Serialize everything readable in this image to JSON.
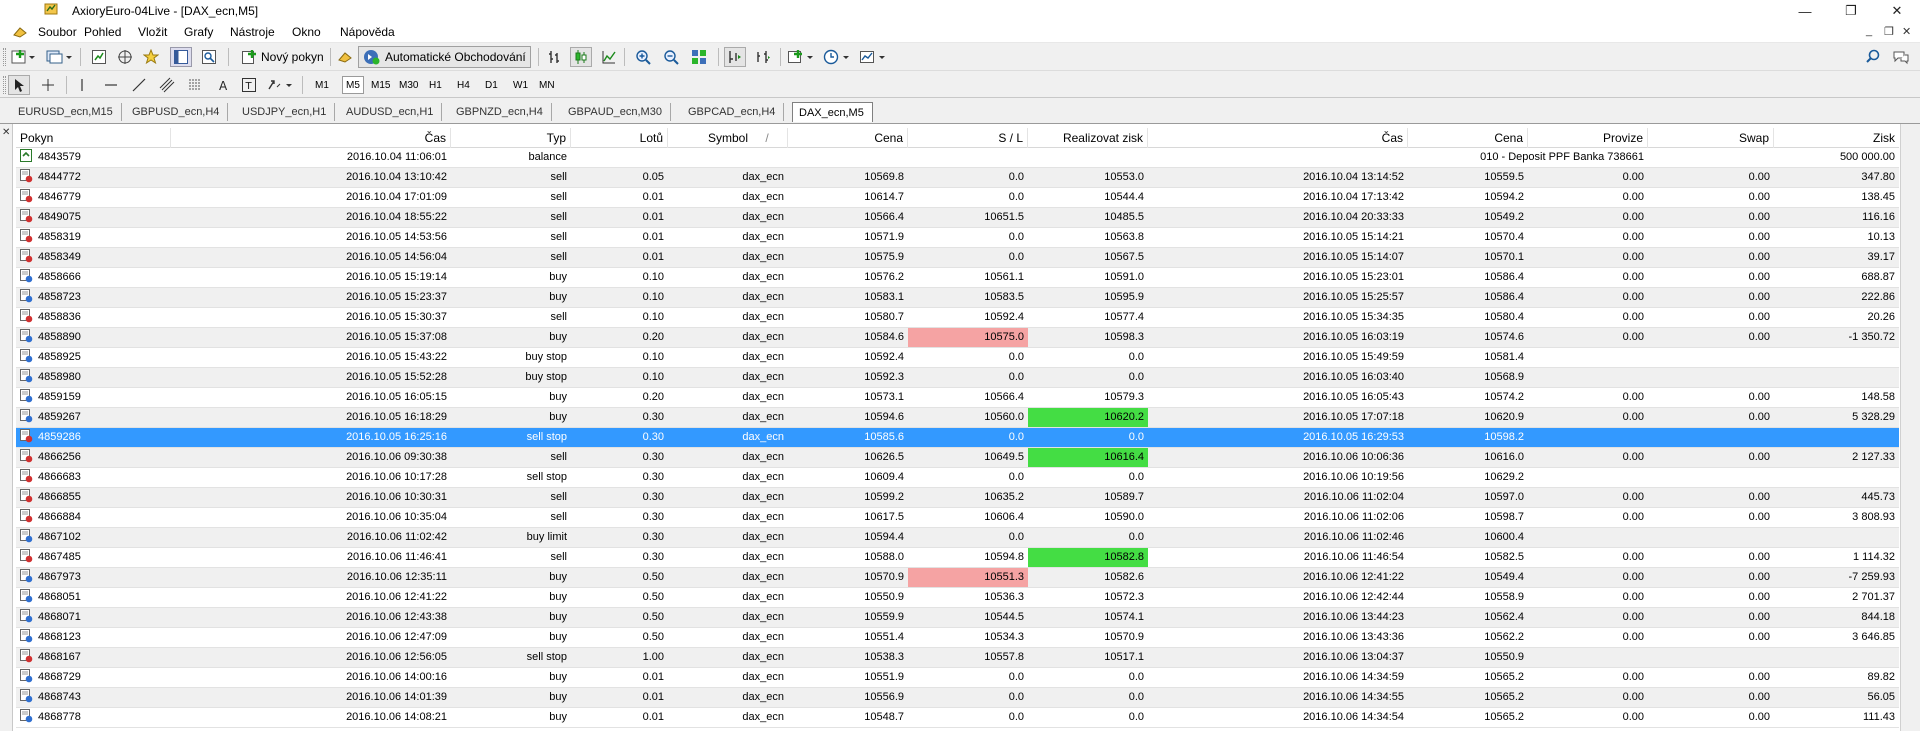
{
  "window": {
    "title": "AxioryEuro-04Live - [DAX_ecn,M5]",
    "minimize": "—",
    "maximize": "❐",
    "close": "✕"
  },
  "menu": {
    "items": [
      "Soubor",
      "Pohled",
      "Vložit",
      "Grafy",
      "Nástroje",
      "Okno",
      "Nápověda"
    ],
    "mdi": [
      "_",
      "❐",
      "✕"
    ]
  },
  "toolbar": {
    "new_order": "Nový pokyn",
    "autotrading": "Automatické Obchodování",
    "timeframes": [
      "M1",
      "M5",
      "M15",
      "M30",
      "H1",
      "H4",
      "D1",
      "W1",
      "MN"
    ],
    "active_timeframe": "M5"
  },
  "tabs": [
    "EURUSD_ecn,M15",
    "GBPUSD_ecn,H4",
    "USDJPY_ecn,H1",
    "AUDUSD_ecn,H1",
    "GBPNZD_ecn,H4",
    "GBPAUD_ecn,M30",
    "GBPCAD_ecn,H4",
    "DAX_ecn,M5"
  ],
  "active_tab": "DAX_ecn,M5",
  "columns": [
    "Pokyn",
    "Čas",
    "Typ",
    "Lotů",
    "Symbol",
    "Cena",
    "S / L",
    "Realizovat zisk",
    "Čas",
    "Cena",
    "Provize",
    "Swap",
    "Zisk"
  ],
  "sort_indicator": "/",
  "colors": {
    "selected": "#3399ff",
    "sl_hit": "#f5a3a3",
    "tp_hit": "#44dd44"
  },
  "rows": [
    {
      "id": "4843579",
      "time": "2016.10.04 11:06:01",
      "type": "balance",
      "lots": "",
      "symbol": "",
      "price": "",
      "sl": "",
      "tp": "",
      "ctime": "",
      "cprice": "",
      "commission": "010 - Deposit PPF Banka  738661",
      "swap": "",
      "profit": "500 000.00",
      "icon": "balance-icon"
    },
    {
      "id": "4844772",
      "time": "2016.10.04 13:10:42",
      "type": "sell",
      "lots": "0.05",
      "symbol": "dax_ecn",
      "price": "10569.8",
      "sl": "0.0",
      "tp": "10553.0",
      "ctime": "2016.10.04 13:14:52",
      "cprice": "10559.5",
      "commission": "0.00",
      "swap": "0.00",
      "profit": "347.80",
      "icon": "sell-icon"
    },
    {
      "id": "4846779",
      "time": "2016.10.04 17:01:09",
      "type": "sell",
      "lots": "0.01",
      "symbol": "dax_ecn",
      "price": "10614.7",
      "sl": "0.0",
      "tp": "10544.4",
      "ctime": "2016.10.04 17:13:42",
      "cprice": "10594.2",
      "commission": "0.00",
      "swap": "0.00",
      "profit": "138.45",
      "icon": "sell-icon"
    },
    {
      "id": "4849075",
      "time": "2016.10.04 18:55:22",
      "type": "sell",
      "lots": "0.01",
      "symbol": "dax_ecn",
      "price": "10566.4",
      "sl": "10651.5",
      "tp": "10485.5",
      "ctime": "2016.10.04 20:33:33",
      "cprice": "10549.2",
      "commission": "0.00",
      "swap": "0.00",
      "profit": "116.16",
      "icon": "sell-icon"
    },
    {
      "id": "4858319",
      "time": "2016.10.05 14:53:56",
      "type": "sell",
      "lots": "0.01",
      "symbol": "dax_ecn",
      "price": "10571.9",
      "sl": "0.0",
      "tp": "10563.8",
      "ctime": "2016.10.05 15:14:21",
      "cprice": "10570.4",
      "commission": "0.00",
      "swap": "0.00",
      "profit": "10.13",
      "icon": "sell-icon"
    },
    {
      "id": "4858349",
      "time": "2016.10.05 14:56:04",
      "type": "sell",
      "lots": "0.01",
      "symbol": "dax_ecn",
      "price": "10575.9",
      "sl": "0.0",
      "tp": "10567.5",
      "ctime": "2016.10.05 15:14:07",
      "cprice": "10570.1",
      "commission": "0.00",
      "swap": "0.00",
      "profit": "39.17",
      "icon": "sell-icon"
    },
    {
      "id": "4858666",
      "time": "2016.10.05 15:19:14",
      "type": "buy",
      "lots": "0.10",
      "symbol": "dax_ecn",
      "price": "10576.2",
      "sl": "10561.1",
      "tp": "10591.0",
      "ctime": "2016.10.05 15:23:01",
      "cprice": "10586.4",
      "commission": "0.00",
      "swap": "0.00",
      "profit": "688.87",
      "icon": "buy-icon"
    },
    {
      "id": "4858723",
      "time": "2016.10.05 15:23:37",
      "type": "buy",
      "lots": "0.10",
      "symbol": "dax_ecn",
      "price": "10583.1",
      "sl": "10583.5",
      "tp": "10595.9",
      "ctime": "2016.10.05 15:25:57",
      "cprice": "10586.4",
      "commission": "0.00",
      "swap": "0.00",
      "profit": "222.86",
      "icon": "buy-icon"
    },
    {
      "id": "4858836",
      "time": "2016.10.05 15:30:37",
      "type": "sell",
      "lots": "0.10",
      "symbol": "dax_ecn",
      "price": "10580.7",
      "sl": "10592.4",
      "tp": "10577.4",
      "ctime": "2016.10.05 15:34:35",
      "cprice": "10580.4",
      "commission": "0.00",
      "swap": "0.00",
      "profit": "20.26",
      "icon": "sell-icon"
    },
    {
      "id": "4858890",
      "time": "2016.10.05 15:37:08",
      "type": "buy",
      "lots": "0.20",
      "symbol": "dax_ecn",
      "price": "10584.6",
      "sl": "10575.0",
      "tp": "10598.3",
      "ctime": "2016.10.05 16:03:19",
      "cprice": "10574.6",
      "commission": "0.00",
      "swap": "0.00",
      "profit": "-1 350.72",
      "icon": "buy-icon",
      "sl_hit": true
    },
    {
      "id": "4858925",
      "time": "2016.10.05 15:43:22",
      "type": "buy stop",
      "lots": "0.10",
      "symbol": "dax_ecn",
      "price": "10592.4",
      "sl": "0.0",
      "tp": "0.0",
      "ctime": "2016.10.05 15:49:59",
      "cprice": "10581.4",
      "commission": "",
      "swap": "",
      "profit": "",
      "icon": "buy-icon"
    },
    {
      "id": "4858980",
      "time": "2016.10.05 15:52:28",
      "type": "buy stop",
      "lots": "0.10",
      "symbol": "dax_ecn",
      "price": "10592.3",
      "sl": "0.0",
      "tp": "0.0",
      "ctime": "2016.10.05 16:03:40",
      "cprice": "10568.9",
      "commission": "",
      "swap": "",
      "profit": "",
      "icon": "buy-icon"
    },
    {
      "id": "4859159",
      "time": "2016.10.05 16:05:15",
      "type": "buy",
      "lots": "0.20",
      "symbol": "dax_ecn",
      "price": "10573.1",
      "sl": "10566.4",
      "tp": "10579.3",
      "ctime": "2016.10.05 16:05:43",
      "cprice": "10574.2",
      "commission": "0.00",
      "swap": "0.00",
      "profit": "148.58",
      "icon": "buy-icon"
    },
    {
      "id": "4859267",
      "time": "2016.10.05 16:18:29",
      "type": "buy",
      "lots": "0.30",
      "symbol": "dax_ecn",
      "price": "10594.6",
      "sl": "10560.0",
      "tp": "10620.2",
      "ctime": "2016.10.05 17:07:18",
      "cprice": "10620.9",
      "commission": "0.00",
      "swap": "0.00",
      "profit": "5 328.29",
      "icon": "buy-icon",
      "tp_hit": true
    },
    {
      "id": "4859286",
      "time": "2016.10.05 16:25:16",
      "type": "sell stop",
      "lots": "0.30",
      "symbol": "dax_ecn",
      "price": "10585.6",
      "sl": "0.0",
      "tp": "0.0",
      "ctime": "2016.10.05 16:29:53",
      "cprice": "10598.2",
      "commission": "",
      "swap": "",
      "profit": "",
      "icon": "sell-icon",
      "selected": true
    },
    {
      "id": "4866256",
      "time": "2016.10.06 09:30:38",
      "type": "sell",
      "lots": "0.30",
      "symbol": "dax_ecn",
      "price": "10626.5",
      "sl": "10649.5",
      "tp": "10616.4",
      "ctime": "2016.10.06 10:06:36",
      "cprice": "10616.0",
      "commission": "0.00",
      "swap": "0.00",
      "profit": "2 127.33",
      "icon": "sell-icon",
      "tp_hit": true
    },
    {
      "id": "4866683",
      "time": "2016.10.06 10:17:28",
      "type": "sell stop",
      "lots": "0.30",
      "symbol": "dax_ecn",
      "price": "10609.4",
      "sl": "0.0",
      "tp": "0.0",
      "ctime": "2016.10.06 10:19:56",
      "cprice": "10629.2",
      "commission": "",
      "swap": "",
      "profit": "",
      "icon": "sell-icon"
    },
    {
      "id": "4866855",
      "time": "2016.10.06 10:30:31",
      "type": "sell",
      "lots": "0.30",
      "symbol": "dax_ecn",
      "price": "10599.2",
      "sl": "10635.2",
      "tp": "10589.7",
      "ctime": "2016.10.06 11:02:04",
      "cprice": "10597.0",
      "commission": "0.00",
      "swap": "0.00",
      "profit": "445.73",
      "icon": "sell-icon"
    },
    {
      "id": "4866884",
      "time": "2016.10.06 10:35:04",
      "type": "sell",
      "lots": "0.30",
      "symbol": "dax_ecn",
      "price": "10617.5",
      "sl": "10606.4",
      "tp": "10590.0",
      "ctime": "2016.10.06 11:02:06",
      "cprice": "10598.7",
      "commission": "0.00",
      "swap": "0.00",
      "profit": "3 808.93",
      "icon": "sell-icon"
    },
    {
      "id": "4867102",
      "time": "2016.10.06 11:02:42",
      "type": "buy limit",
      "lots": "0.30",
      "symbol": "dax_ecn",
      "price": "10594.4",
      "sl": "0.0",
      "tp": "0.0",
      "ctime": "2016.10.06 11:02:46",
      "cprice": "10600.4",
      "commission": "",
      "swap": "",
      "profit": "",
      "icon": "buy-icon"
    },
    {
      "id": "4867485",
      "time": "2016.10.06 11:46:41",
      "type": "sell",
      "lots": "0.30",
      "symbol": "dax_ecn",
      "price": "10588.0",
      "sl": "10594.8",
      "tp": "10582.8",
      "ctime": "2016.10.06 11:46:54",
      "cprice": "10582.5",
      "commission": "0.00",
      "swap": "0.00",
      "profit": "1 114.32",
      "icon": "sell-icon",
      "tp_hit": true
    },
    {
      "id": "4867973",
      "time": "2016.10.06 12:35:11",
      "type": "buy",
      "lots": "0.50",
      "symbol": "dax_ecn",
      "price": "10570.9",
      "sl": "10551.3",
      "tp": "10582.6",
      "ctime": "2016.10.06 12:41:22",
      "cprice": "10549.4",
      "commission": "0.00",
      "swap": "0.00",
      "profit": "-7 259.93",
      "icon": "buy-icon",
      "sl_hit": true
    },
    {
      "id": "4868051",
      "time": "2016.10.06 12:41:22",
      "type": "buy",
      "lots": "0.50",
      "symbol": "dax_ecn",
      "price": "10550.9",
      "sl": "10536.3",
      "tp": "10572.3",
      "ctime": "2016.10.06 12:42:44",
      "cprice": "10558.9",
      "commission": "0.00",
      "swap": "0.00",
      "profit": "2 701.37",
      "icon": "buy-icon"
    },
    {
      "id": "4868071",
      "time": "2016.10.06 12:43:38",
      "type": "buy",
      "lots": "0.50",
      "symbol": "dax_ecn",
      "price": "10559.9",
      "sl": "10544.5",
      "tp": "10574.1",
      "ctime": "2016.10.06 13:44:23",
      "cprice": "10562.4",
      "commission": "0.00",
      "swap": "0.00",
      "profit": "844.18",
      "icon": "buy-icon"
    },
    {
      "id": "4868123",
      "time": "2016.10.06 12:47:09",
      "type": "buy",
      "lots": "0.50",
      "symbol": "dax_ecn",
      "price": "10551.4",
      "sl": "10534.3",
      "tp": "10570.9",
      "ctime": "2016.10.06 13:43:36",
      "cprice": "10562.2",
      "commission": "0.00",
      "swap": "0.00",
      "profit": "3 646.85",
      "icon": "buy-icon"
    },
    {
      "id": "4868167",
      "time": "2016.10.06 12:56:05",
      "type": "sell stop",
      "lots": "1.00",
      "symbol": "dax_ecn",
      "price": "10538.3",
      "sl": "10557.8",
      "tp": "10517.1",
      "ctime": "2016.10.06 13:04:37",
      "cprice": "10550.9",
      "commission": "",
      "swap": "",
      "profit": "",
      "icon": "sell-icon"
    },
    {
      "id": "4868729",
      "time": "2016.10.06 14:00:16",
      "type": "buy",
      "lots": "0.01",
      "symbol": "dax_ecn",
      "price": "10551.9",
      "sl": "0.0",
      "tp": "0.0",
      "ctime": "2016.10.06 14:34:59",
      "cprice": "10565.2",
      "commission": "0.00",
      "swap": "0.00",
      "profit": "89.82",
      "icon": "buy-icon"
    },
    {
      "id": "4868743",
      "time": "2016.10.06 14:01:39",
      "type": "buy",
      "lots": "0.01",
      "symbol": "dax_ecn",
      "price": "10556.9",
      "sl": "0.0",
      "tp": "0.0",
      "ctime": "2016.10.06 14:34:55",
      "cprice": "10565.2",
      "commission": "0.00",
      "swap": "0.00",
      "profit": "56.05",
      "icon": "buy-icon"
    },
    {
      "id": "4868778",
      "time": "2016.10.06 14:08:21",
      "type": "buy",
      "lots": "0.01",
      "symbol": "dax_ecn",
      "price": "10548.7",
      "sl": "0.0",
      "tp": "0.0",
      "ctime": "2016.10.06 14:34:54",
      "cprice": "10565.2",
      "commission": "0.00",
      "swap": "0.00",
      "profit": "111.43",
      "icon": "buy-icon"
    }
  ]
}
